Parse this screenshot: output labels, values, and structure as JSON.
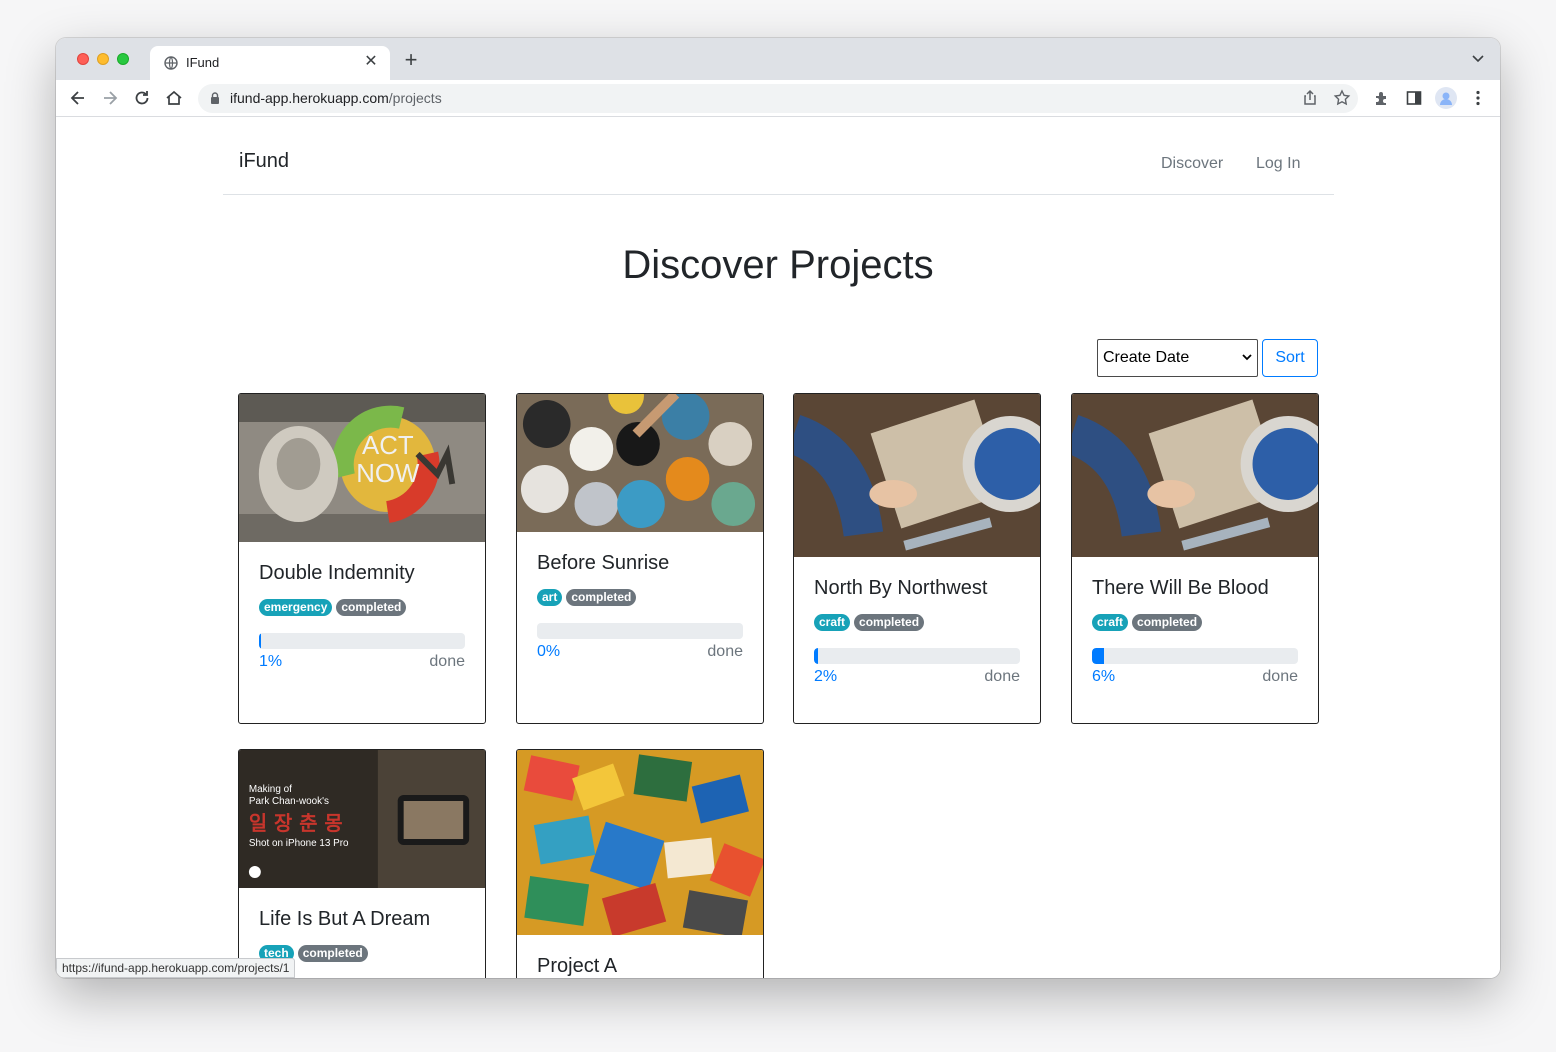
{
  "browser": {
    "tab_title": "IFund",
    "url_host": "ifund-app.herokuapp.com",
    "url_path": "/projects",
    "status_url": "https://ifund-app.herokuapp.com/projects/1"
  },
  "navbar": {
    "brand": "iFund",
    "links": [
      "Discover",
      "Log In"
    ]
  },
  "header": {
    "title": "Discover Projects"
  },
  "sort": {
    "selected": "Create Date",
    "button_label": "Sort"
  },
  "projects": [
    {
      "title": "Double Indemnity",
      "category": "emergency",
      "status": "completed",
      "progress": 1,
      "progress_label": "1%",
      "done_label": "done"
    },
    {
      "title": "Before Sunrise",
      "category": "art",
      "status": "completed",
      "progress": 0,
      "progress_label": "0%",
      "done_label": "done"
    },
    {
      "title": "North By Northwest",
      "category": "craft",
      "status": "completed",
      "progress": 2,
      "progress_label": "2%",
      "done_label": "done"
    },
    {
      "title": "There Will Be Blood",
      "category": "craft",
      "status": "completed",
      "progress": 6,
      "progress_label": "6%",
      "done_label": "done"
    },
    {
      "title": "Life Is But A Dream",
      "category": "tech",
      "status": "completed"
    },
    {
      "title": "Project A"
    }
  ],
  "image_text": {
    "act_now_1": "ACT",
    "act_now_2": "NOW",
    "film_line1": "Making of",
    "film_line2": "Park Chan-wook's",
    "film_line3": "일 장 춘 몽",
    "film_line4": "Shot on iPhone 13 Pro"
  },
  "colors": {
    "primary": "#007bff",
    "info": "#17a2b8",
    "secondary": "#6c757d"
  }
}
